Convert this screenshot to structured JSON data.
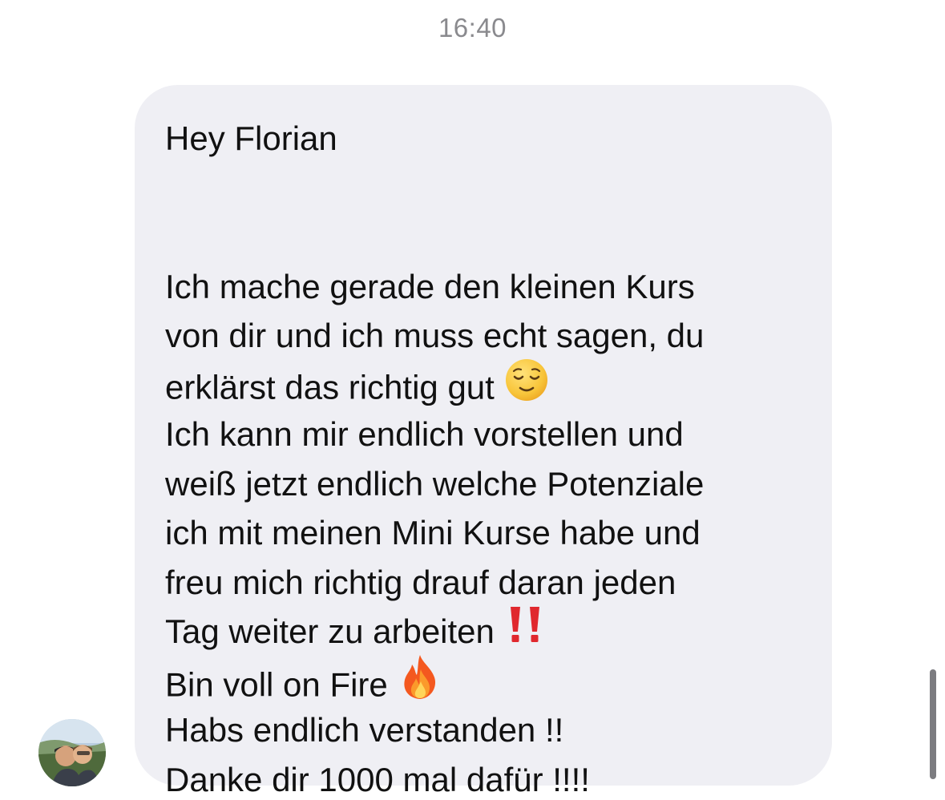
{
  "conversation": {
    "timestamp": "16:40"
  },
  "message": {
    "lines": {
      "l1": "Hey Florian",
      "l2": "Ich mache gerade den kleinen Kurs",
      "l3": "von dir und ich muss echt sagen, du",
      "l4": "erklärst das richtig gut",
      "l5": "Ich kann mir endlich vorstellen und",
      "l6": "weiß jetzt endlich welche Potenziale",
      "l7": "ich mit meinen Mini Kurse habe und",
      "l8": "freu mich richtig drauf daran jeden",
      "l9": "Tag weiter zu arbeiten",
      "l10": "Bin voll on Fire",
      "l11": "Habs endlich verstanden !!",
      "l12": "Danke dir 1000 mal dafür !!!!"
    },
    "emojis": {
      "after_l4": "relieved-face-icon",
      "after_l9": "double-exclamation-icon",
      "after_l10": "fire-icon"
    }
  },
  "colors": {
    "bubble_background": "#efeff4",
    "timestamp_text": "#8a8a8e",
    "message_text": "#111111",
    "exclamation_red": "#e0282e"
  }
}
